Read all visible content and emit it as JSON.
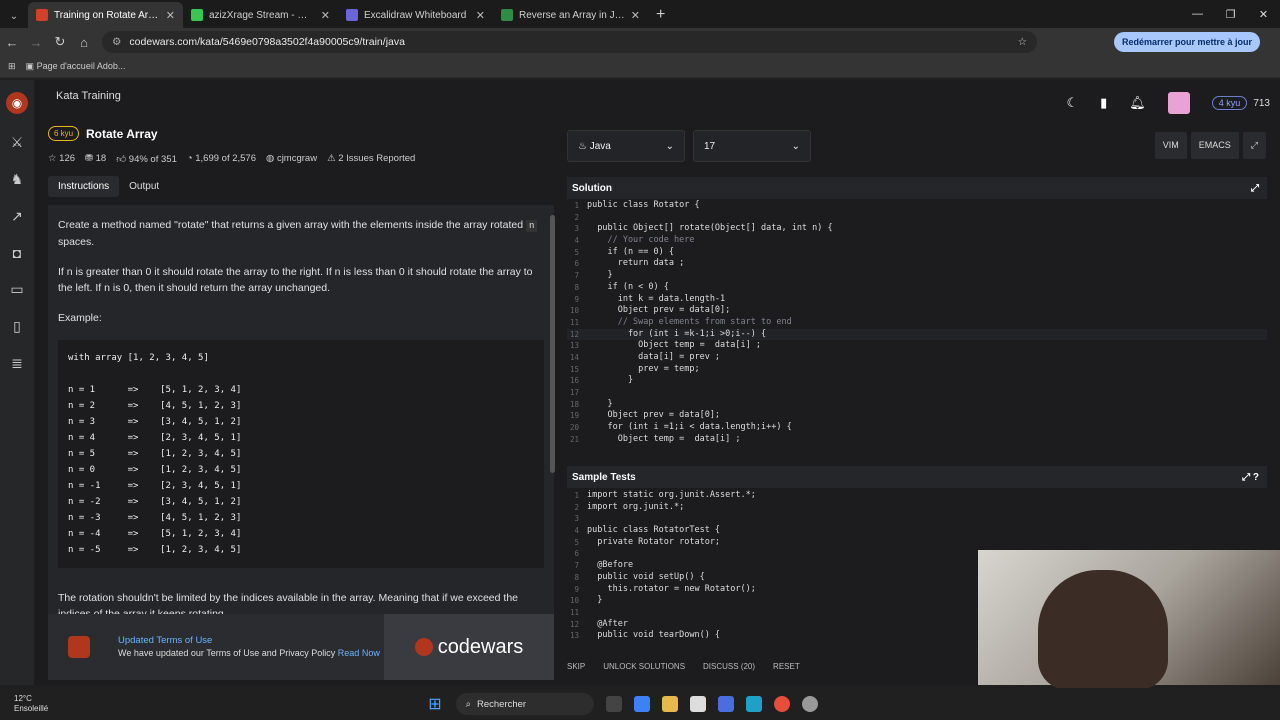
{
  "browser": {
    "tabs": [
      {
        "title": "Training on Rotate Array | Code",
        "color": "#d33f27",
        "active": true
      },
      {
        "title": "azizXrage Stream - Watch Live",
        "color": "#38c74f",
        "active": false
      },
      {
        "title": "Excalidraw Whiteboard",
        "color": "#6965db",
        "active": false
      },
      {
        "title": "Reverse an Array in Java - Geek",
        "color": "#2f8d46",
        "active": false
      }
    ],
    "url": "codewars.com/kata/5469e0798a3502f4a90005c9/train/java",
    "restart_label": "Redémarrer pour mettre à jour",
    "bookmark": "Page d'accueil Adob..."
  },
  "header": {
    "breadcrumb": "Kata Training",
    "rank": "4 kyu",
    "honor": "713"
  },
  "kata": {
    "kyu": "6 kyu",
    "title": "Rotate Array",
    "stars": "126",
    "collections": "18",
    "satisfaction": "94% of 351",
    "completed": "1,699 of 2,576",
    "author": "cjmcgraw",
    "issues": "2 Issues Reported"
  },
  "left_tabs": {
    "instructions": "Instructions",
    "output": "Output"
  },
  "description": {
    "p1a": "Create a method named \"rotate\" that returns a given array with the elements inside the array rotated",
    "p1code": "n",
    "p1b": "spaces.",
    "p2": "If n is greater than 0 it should rotate the array to the right. If n is less than 0 it should rotate the array to the left. If n is 0, then it should return the array unchanged.",
    "example": "Example:",
    "code_lines": [
      "with array [1, 2, 3, 4, 5]",
      "",
      "n = 1      =>    [5, 1, 2, 3, 4]",
      "n = 2      =>    [4, 5, 1, 2, 3]",
      "n = 3      =>    [3, 4, 5, 1, 2]",
      "n = 4      =>    [2, 3, 4, 5, 1]",
      "n = 5      =>    [1, 2, 3, 4, 5]",
      "n = 0      =>    [1, 2, 3, 4, 5]",
      "n = -1     =>    [2, 3, 4, 5, 1]",
      "n = -2     =>    [3, 4, 5, 1, 2]",
      "n = -3     =>    [4, 5, 1, 2, 3]",
      "n = -4     =>    [5, 1, 2, 3, 4]",
      "n = -5     =>    [1, 2, 3, 4, 5]"
    ],
    "p3": "The rotation shouldn't be limited by the indices available in the array. Meaning that if we exceed the indices of the array it keeps rotating."
  },
  "cookie": {
    "heading": "Updated Terms of Use",
    "text": "We have updated our Terms of Use and Privacy Policy",
    "link": "Read Now",
    "brand": "codewars"
  },
  "editor": {
    "language": "Java",
    "version": "17",
    "mode_vim": "VIM",
    "mode_emacs": "EMACS",
    "solution_title": "Solution",
    "solution_lines": [
      "public class Rotator {",
      "",
      "  public Object[] rotate(Object[] data, int n) {",
      "    // Your code here",
      "    if (n == 0) {",
      "      return data ;",
      "    }",
      "    if (n < 0) {",
      "      int k = data.length-1",
      "      Object prev = data[0];",
      "      // Swap elements from start to end",
      "        for (int i =k-1;i >0;i--) {",
      "          Object temp =  data[i] ;",
      "          data[i] = prev ;",
      "          prev = temp;",
      "        }",
      "",
      "    }",
      "    Object prev = data[0];",
      "    for (int i =1;i < data.length;i++) {",
      "      Object temp =  data[i] ;"
    ],
    "tests_title": "Sample Tests",
    "test_lines": [
      "import static org.junit.Assert.*;",
      "import org.junit.*;",
      "",
      "public class RotatorTest {",
      "  private Rotator rotator;",
      "",
      "  @Before",
      "  public void setUp() {",
      "    this.rotator = new Rotator();",
      "  }",
      "",
      "  @After",
      "  public void tearDown() {"
    ],
    "footer": {
      "skip": "SKIP",
      "unlock": "UNLOCK SOLUTIONS",
      "discuss": "DISCUSS (20)",
      "reset": "RESET"
    }
  },
  "taskbar": {
    "temp": "12°C",
    "weather": "Ensoleillé",
    "search": "Rechercher"
  }
}
